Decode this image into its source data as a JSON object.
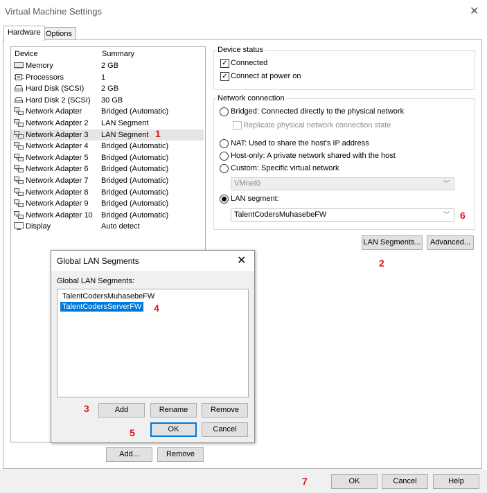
{
  "window": {
    "title": "Virtual Machine Settings"
  },
  "tabs": [
    {
      "label": "Hardware"
    },
    {
      "label": "Options"
    }
  ],
  "device_list": {
    "headers": {
      "device": "Device",
      "summary": "Summary"
    },
    "rows": [
      {
        "name": "Memory",
        "summary": "2 GB",
        "icon": "memory-icon"
      },
      {
        "name": "Processors",
        "summary": "1",
        "icon": "processor-icon"
      },
      {
        "name": "Hard Disk (SCSI)",
        "summary": "2 GB",
        "icon": "hard-disk-icon"
      },
      {
        "name": "Hard Disk 2 (SCSI)",
        "summary": "30 GB",
        "icon": "hard-disk-icon"
      },
      {
        "name": "Network Adapter",
        "summary": "Bridged (Automatic)",
        "icon": "network-adapter-icon"
      },
      {
        "name": "Network Adapter 2",
        "summary": "LAN Segment",
        "icon": "network-adapter-icon"
      },
      {
        "name": "Network Adapter 3",
        "summary": "LAN Segment",
        "icon": "network-adapter-icon"
      },
      {
        "name": "Network Adapter 4",
        "summary": "Bridged (Automatic)",
        "icon": "network-adapter-icon"
      },
      {
        "name": "Network Adapter 5",
        "summary": "Bridged (Automatic)",
        "icon": "network-adapter-icon"
      },
      {
        "name": "Network Adapter 6",
        "summary": "Bridged (Automatic)",
        "icon": "network-adapter-icon"
      },
      {
        "name": "Network Adapter 7",
        "summary": "Bridged (Automatic)",
        "icon": "network-adapter-icon"
      },
      {
        "name": "Network Adapter 8",
        "summary": "Bridged (Automatic)",
        "icon": "network-adapter-icon"
      },
      {
        "name": "Network Adapter 9",
        "summary": "Bridged (Automatic)",
        "icon": "network-adapter-icon"
      },
      {
        "name": "Network Adapter 10",
        "summary": "Bridged (Automatic)",
        "icon": "network-adapter-icon"
      },
      {
        "name": "Display",
        "summary": "Auto detect",
        "icon": "display-icon"
      }
    ],
    "selected_index": 6
  },
  "device_status": {
    "label": "Device status",
    "connected": "Connected",
    "connect_at_power_on": "Connect at power on"
  },
  "network_connection": {
    "label": "Network connection",
    "bridged": "Bridged: Connected directly to the physical network",
    "replicate": "Replicate physical network connection state",
    "nat": "NAT: Used to share the host's IP address",
    "host_only": "Host-only: A private network shared with the host",
    "custom": "Custom: Specific virtual network",
    "custom_value": "VMnet0",
    "lan_segment": "LAN segment:",
    "lan_segment_value": "TalentCodersMuhasebeFW",
    "selected": "lan_segment"
  },
  "buttons": {
    "lan_segments": "LAN Segments...",
    "advanced": "Advanced...",
    "add": "Add...",
    "remove": "Remove",
    "ok": "OK",
    "cancel": "Cancel",
    "help": "Help"
  },
  "dialog": {
    "title": "Global LAN Segments",
    "list_label": "Global LAN Segments:",
    "segments": [
      "TalentCodersMuhasebeFW",
      "TalentCodersServerFW"
    ],
    "selected_index": 1,
    "add": "Add",
    "rename": "Rename",
    "remove": "Remove",
    "ok": "OK",
    "cancel": "Cancel"
  },
  "annotations": [
    "1",
    "2",
    "3",
    "4",
    "5",
    "6",
    "7"
  ],
  "colors": {
    "accent": "#0078d7",
    "marker": "#e0141e",
    "selected_row": "#e5e5e5"
  }
}
